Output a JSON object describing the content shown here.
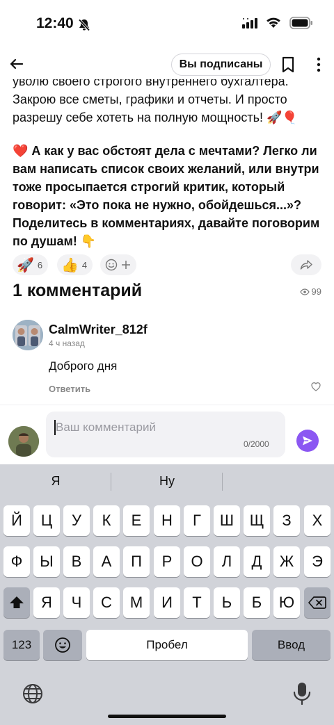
{
  "status_bar": {
    "time": "12:40"
  },
  "header": {
    "subscribed_label": "Вы подписаны"
  },
  "article": {
    "paragraph1": "уволю своего строгого внутреннего бухгалтера. Закрою все сметы, графики и отчеты. И просто разрешу себе хотеть на полную мощность! 🚀🎈",
    "paragraph2": "❤️ А как у вас обстоят дела с мечтами? Легко ли вам написать список своих желаний, или внутри тоже просыпается строгий критик, который говорит: «Это пока не нужно, обойдешься...»? Поделитесь в комментариях, давайте поговорим по душам! 👇"
  },
  "reactions": [
    {
      "emoji": "🚀",
      "count": "6"
    },
    {
      "emoji": "👍",
      "count": "4"
    }
  ],
  "comments_section": {
    "title": "1 комментарий",
    "views": "99"
  },
  "comment": {
    "author": "CalmWriter_812f",
    "time": "4 ч назад",
    "text": "Доброго дня",
    "reply_label": "Ответить"
  },
  "composer": {
    "placeholder": "Ваш комментарий",
    "counter": "0/2000"
  },
  "keyboard": {
    "suggestions": [
      "Я",
      "Ну"
    ],
    "row1": [
      "Й",
      "Ц",
      "У",
      "К",
      "Е",
      "Н",
      "Г",
      "Ш",
      "Щ",
      "З",
      "Х"
    ],
    "row2": [
      "Ф",
      "Ы",
      "В",
      "А",
      "П",
      "Р",
      "О",
      "Л",
      "Д",
      "Ж",
      "Э"
    ],
    "row3": [
      "Я",
      "Ч",
      "С",
      "М",
      "И",
      "Т",
      "Ь",
      "Б",
      "Ю"
    ],
    "numbers_label": "123",
    "space_label": "Пробел",
    "return_label": "Ввод"
  },
  "colors": {
    "accent": "#8b57f2",
    "keyboard_bg": "#d1d3d9"
  }
}
